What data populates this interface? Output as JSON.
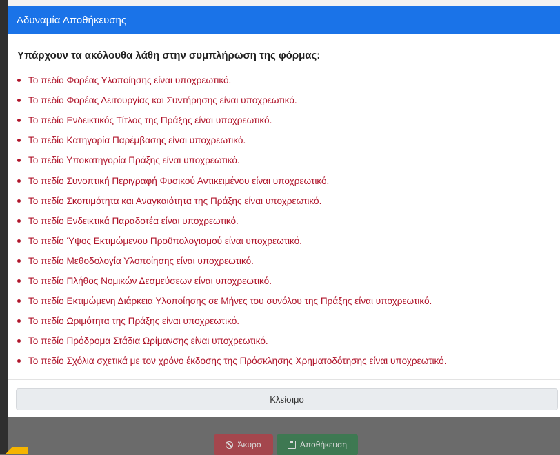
{
  "dialog": {
    "title": "Αδυναμία Αποθήκευσης",
    "intro": "Υπάρχουν τα ακόλουθα λάθη στην συμπλήρωση της φόρμας:",
    "errors": [
      "Το πεδίο Φορέας Υλοποίησης είναι υποχρεωτικό.",
      "Το πεδίο Φορέας Λειτουργίας και Συντήρησης είναι υποχρεωτικό.",
      "Το πεδίο Ενδεικτικός Τίτλος της Πράξης είναι υποχρεωτικό.",
      "Το πεδίο Κατηγορία Παρέμβασης είναι υποχρεωτικό.",
      "Το πεδίο Υποκατηγορία Πράξης είναι υποχρεωτικό.",
      "Το πεδίο Συνοπτική Περιγραφή Φυσικού Αντικειμένου είναι υποχρεωτικό.",
      "Το πεδίο Σκοπιμότητα και Αναγκαιότητα της Πράξης είναι υποχρεωτικό.",
      "Το πεδίο Ενδεικτικά Παραδοτέα είναι υποχρεωτικό.",
      "Το πεδίο Ύψος Εκτιμώμενου Προϋπολογισμού είναι υποχρεωτικό.",
      "Το πεδίο Μεθοδολογία Υλοποίησης είναι υποχρεωτικό.",
      "Το πεδίο Πλήθος Νομικών Δεσμεύσεων είναι υποχρεωτικό.",
      "Το πεδίο Εκτιμώμενη Διάρκεια Υλοποίησης σε Μήνες του συνόλου της Πράξης είναι υποχρεωτικό.",
      "Το πεδίο Ωριμότητα της Πράξης είναι υποχρεωτικό.",
      "Το πεδίο Πρόδρομα Στάδια Ωρίμανσης είναι υποχρεωτικό.",
      "Το πεδίο Σχόλια σχετικά με τον χρόνο έκδοσης της Πρόσκλησης Χρηματοδότησης είναι υποχρεωτικό."
    ],
    "close_label": "Κλείσιμο"
  },
  "background_form": {
    "cancel_label": "Άκυρο",
    "save_label": "Αποθήκευση"
  },
  "colors": {
    "header": "#1a73e8",
    "error_text": "#b0152b",
    "overlay": "#6b6b6b",
    "cancel": "#b73a43",
    "save": "#2f7d4a"
  },
  "icons": {
    "cancel": "ban-icon",
    "save": "save-icon"
  }
}
